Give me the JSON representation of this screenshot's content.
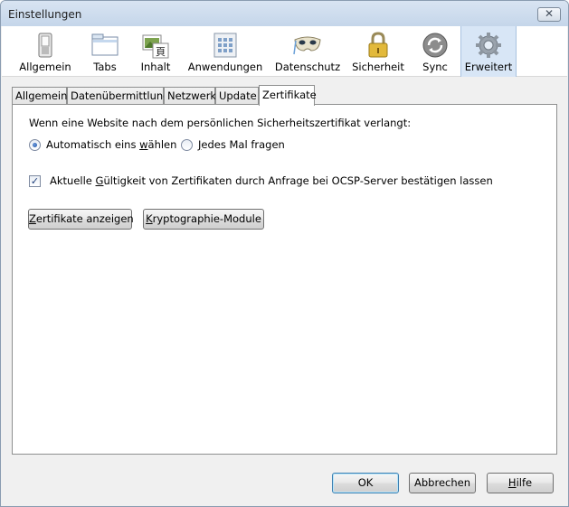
{
  "window": {
    "title": "Einstellungen",
    "close_glyph": "✕"
  },
  "toolbar": {
    "items": [
      {
        "label": "Allgemein",
        "icon": "switch-icon"
      },
      {
        "label": "Tabs",
        "icon": "tabs-icon"
      },
      {
        "label": "Inhalt",
        "icon": "content-icon"
      },
      {
        "label": "Anwendungen",
        "icon": "applications-icon"
      },
      {
        "label": "Datenschutz",
        "icon": "privacy-mask-icon"
      },
      {
        "label": "Sicherheit",
        "icon": "padlock-icon"
      },
      {
        "label": "Sync",
        "icon": "sync-icon"
      },
      {
        "label": "Erweitert",
        "icon": "gear-icon"
      }
    ],
    "active": "Erweitert"
  },
  "tabs": {
    "items": [
      "Allgemein",
      "Datenübermittlung",
      "Netzwerk",
      "Update",
      "Zertifikate"
    ],
    "active": "Zertifikate"
  },
  "certificates": {
    "prompt": "Wenn eine Website nach dem persönlichen Sicherheitszertifikat verlangt:",
    "radio_auto": {
      "pre": "Automatisch eins ",
      "key": "w",
      "post": "ählen",
      "selected": true
    },
    "radio_ask": {
      "pre": "",
      "key": "J",
      "post": "edes Mal fragen",
      "selected": false
    },
    "ocsp": {
      "pre": "Aktuelle ",
      "key": "G",
      "post": "ültigkeit von Zertifikaten durch Anfrage bei OCSP-Server bestätigen lassen",
      "checked": true
    },
    "view_button": {
      "pre": "",
      "key": "Z",
      "post": "ertifikate anzeigen"
    },
    "modules_button": {
      "pre": "",
      "key": "K",
      "post": "ryptographie-Module"
    }
  },
  "footer": {
    "ok": "OK",
    "cancel": "Abbrechen",
    "help": {
      "pre": "",
      "key": "H",
      "post": "ilfe"
    }
  },
  "colors": {
    "accent": "#d8e6f6",
    "window_bg": "#f0f0f0",
    "titlebar": "#c5d6ea"
  }
}
